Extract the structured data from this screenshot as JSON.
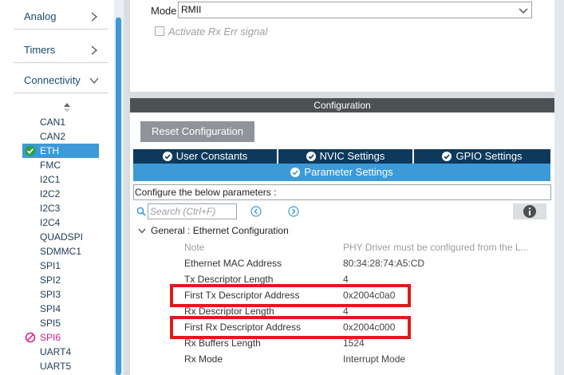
{
  "sidebar": {
    "categories": [
      {
        "label": "Analog",
        "state": "collapsed"
      },
      {
        "label": "Timers",
        "state": "collapsed"
      },
      {
        "label": "Connectivity",
        "state": "expanded"
      }
    ],
    "peripherals": [
      {
        "label": "CAN1",
        "status": "none"
      },
      {
        "label": "CAN2",
        "status": "none"
      },
      {
        "label": "ETH",
        "status": "enabled",
        "selected": true
      },
      {
        "label": "FMC",
        "status": "none"
      },
      {
        "label": "I2C1",
        "status": "none"
      },
      {
        "label": "I2C2",
        "status": "none"
      },
      {
        "label": "I2C3",
        "status": "none"
      },
      {
        "label": "I2C4",
        "status": "none"
      },
      {
        "label": "QUADSPI",
        "status": "none"
      },
      {
        "label": "SDMMC1",
        "status": "none"
      },
      {
        "label": "SPI1",
        "status": "none"
      },
      {
        "label": "SPI2",
        "status": "none"
      },
      {
        "label": "SPI3",
        "status": "none"
      },
      {
        "label": "SPI4",
        "status": "none"
      },
      {
        "label": "SPI5",
        "status": "none"
      },
      {
        "label": "SPI6",
        "status": "disabled"
      },
      {
        "label": "UART4",
        "status": "none"
      },
      {
        "label": "UART5",
        "status": "none"
      }
    ]
  },
  "mode": {
    "label": "Mode",
    "value": "RMII",
    "rx_err_label": "Activate Rx Err signal"
  },
  "configuration": {
    "title": "Configuration",
    "reset_label": "Reset Configuration",
    "tabs": [
      "User Constants",
      "NVIC Settings",
      "GPIO Settings"
    ],
    "active_tab": "Parameter Settings",
    "instruction": "Configure the below parameters :",
    "search_placeholder": "Search (Ctrl+F)",
    "group_title": "General : Ethernet Configuration",
    "params": [
      {
        "name": "Note",
        "value": "PHY Driver must be configured from the L..."
      },
      {
        "name": "Ethernet MAC Address",
        "value": "80:34:28:74:A5:CD"
      },
      {
        "name": "Tx Descriptor Length",
        "value": "4"
      },
      {
        "name": "First Tx Descriptor Address",
        "value": "0x2004c0a0"
      },
      {
        "name": "Rx Descriptor Length",
        "value": "4"
      },
      {
        "name": "First Rx Descriptor Address",
        "value": "0x2004c000"
      },
      {
        "name": "Rx Buffers Length",
        "value": "1524"
      },
      {
        "name": "Rx Mode",
        "value": "Interrupt Mode"
      }
    ]
  },
  "colors": {
    "accent": "#3d9ad6",
    "tab_dark": "#0d3a5c",
    "header_bar": "#4c5154",
    "highlight": "#e0191e",
    "enabled_green": "#2e9d47",
    "disabled_magenta": "#d21d8e"
  }
}
